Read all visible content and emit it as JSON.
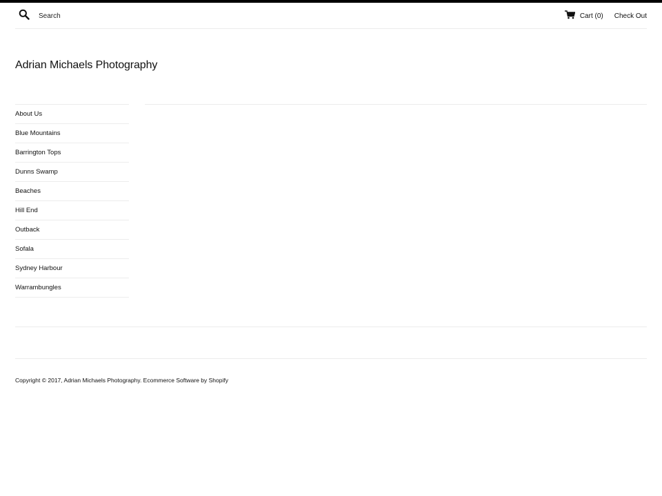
{
  "header": {
    "search_placeholder": "Search",
    "search_icon": "search-icon",
    "cart_icon": "cart-icon",
    "cart_label": "Cart",
    "cart_count": "(0)",
    "checkout_label": "Check Out"
  },
  "site": {
    "title": "Adrian Michaels Photography"
  },
  "sidebar": {
    "items": [
      {
        "label": "About Us"
      },
      {
        "label": "Blue Mountains"
      },
      {
        "label": "Barrington Tops"
      },
      {
        "label": "Dunns Swamp"
      },
      {
        "label": "Beaches"
      },
      {
        "label": "Hill End"
      },
      {
        "label": "Outback"
      },
      {
        "label": "Sofala"
      },
      {
        "label": "Sydney Harbour"
      },
      {
        "label": "Warrambungles"
      }
    ]
  },
  "footer": {
    "copyright_prefix": "Copyright © 2017, ",
    "site_link": "Adrian Michaels Photography",
    "separator": ". ",
    "platform_link": "Ecommerce Software by Shopify"
  }
}
